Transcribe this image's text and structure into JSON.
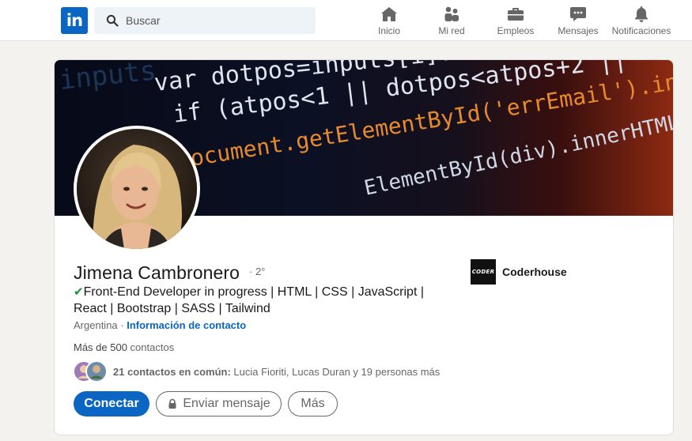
{
  "nav": {
    "logo_text": "in",
    "search": {
      "placeholder": "Buscar"
    },
    "items": [
      {
        "label": "Inicio",
        "icon": "home-icon"
      },
      {
        "label": "Mi red",
        "icon": "people-icon"
      },
      {
        "label": "Empleos",
        "icon": "briefcase-icon"
      },
      {
        "label": "Mensajes",
        "icon": "chat-icon"
      },
      {
        "label": "Notificaciones",
        "icon": "bell-icon"
      }
    ]
  },
  "banner": {
    "code_lines": [
      "inputs",
      "var dotpos=inputs[i].",
      "if (atpos<1 || dotpos<atpos+2 ||",
      "ocument.getElementById('errEmail').innerHTML",
      "ElementById(div).innerHTML"
    ]
  },
  "profile": {
    "name": "Jimena Cambronero",
    "degree": "· 2°",
    "headline_icon": "check-icon",
    "headline": "Front-End Developer in progress | HTML | CSS | JavaScript | React | Bootstrap | SASS | Tailwind",
    "location": "Argentina",
    "separator": " · ",
    "contact_info": "Información de contacto",
    "connections_count": "Más de 500",
    "connections_label": " contactos",
    "mutual_count": "21 contactos en común:",
    "mutual_names": " Lucia Fioriti, Lucas Duran y 19 personas más"
  },
  "company": {
    "logo_text": "CODER",
    "name": "Coderhouse"
  },
  "actions": {
    "connect": "Conectar",
    "message": "Enviar mensaje",
    "more": "Más"
  },
  "colors": {
    "brand": "#0a66c2",
    "check": "#1a8f3c",
    "background": "#f3f2ef"
  }
}
